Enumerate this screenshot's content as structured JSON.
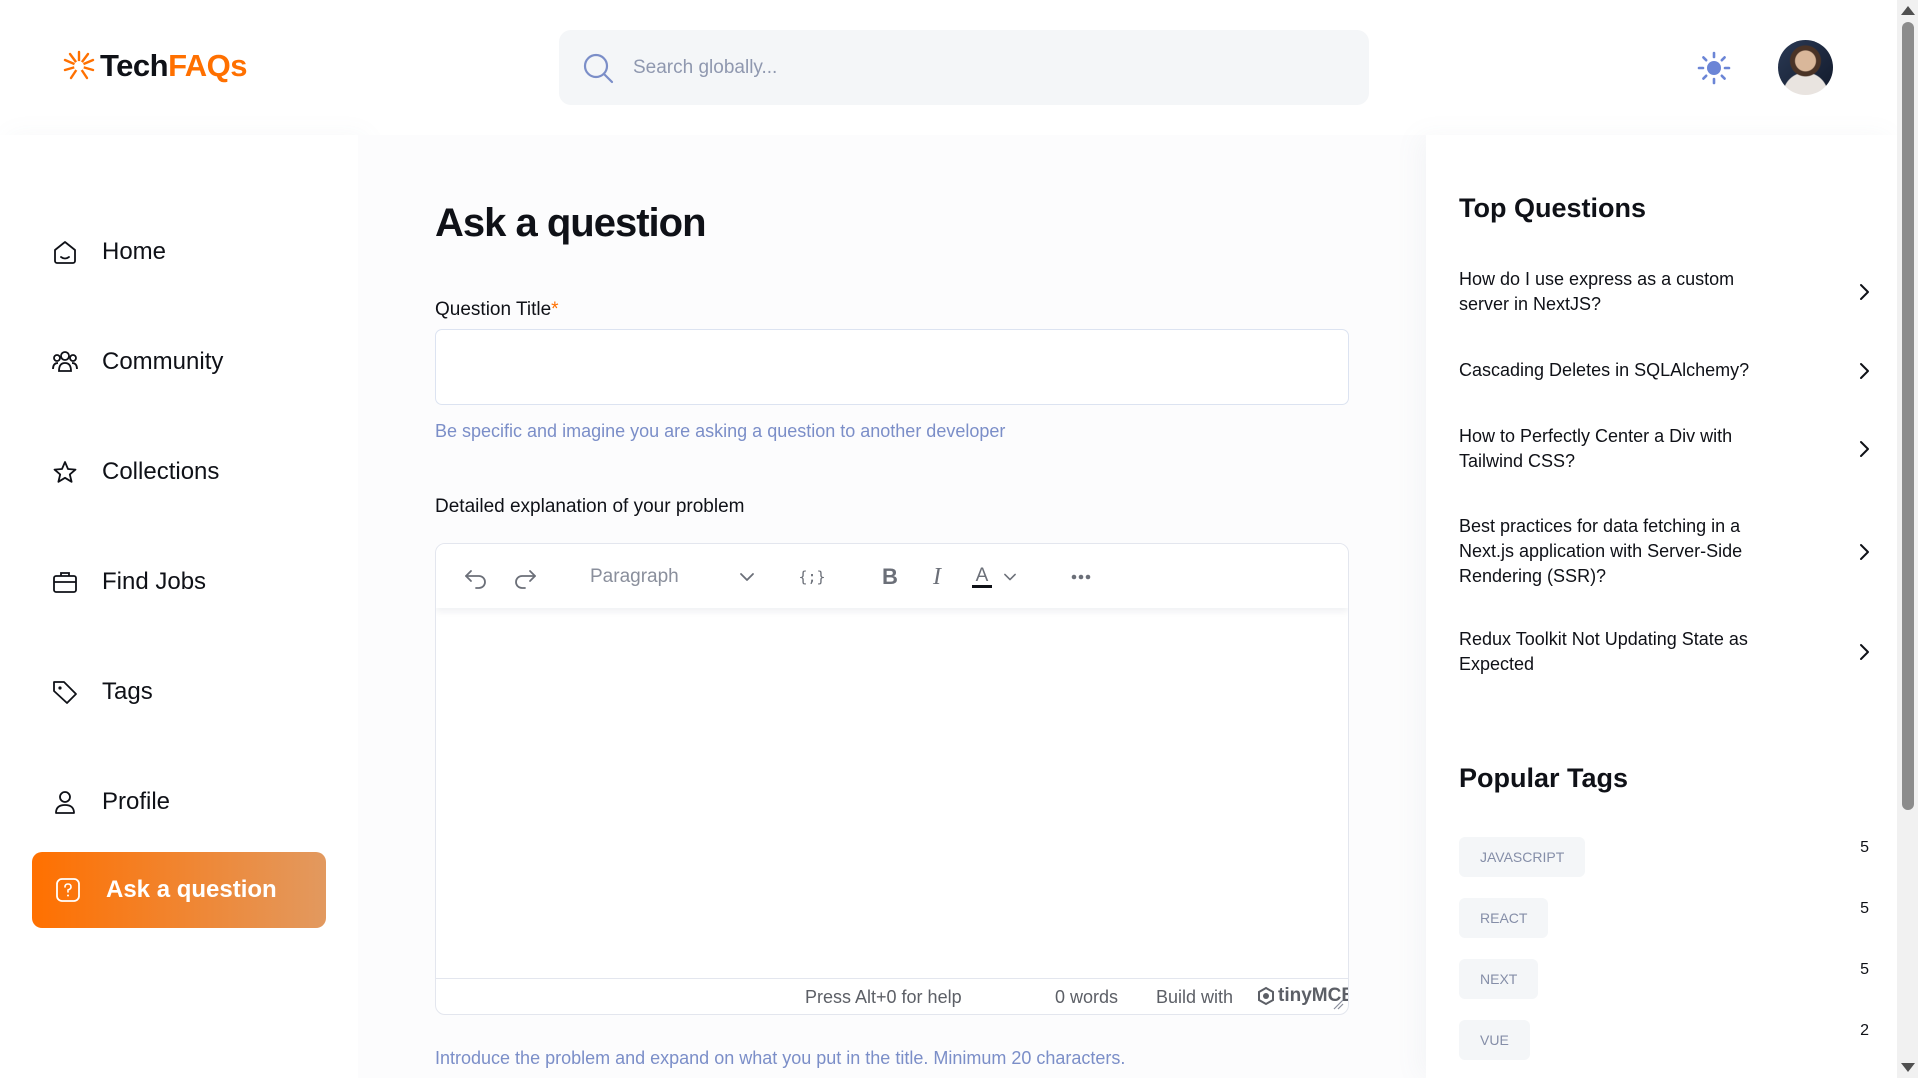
{
  "brand": {
    "name_part1": "Tech",
    "name_part2": "FAQs",
    "accent": "#ff7000"
  },
  "search": {
    "placeholder": "Search globally...",
    "icon": "search-icon"
  },
  "header": {
    "theme_icon": "sun-icon"
  },
  "sidebar": {
    "items": [
      {
        "label": "Home",
        "icon": "home-icon"
      },
      {
        "label": "Community",
        "icon": "users-icon"
      },
      {
        "label": "Collections",
        "icon": "star-icon"
      },
      {
        "label": "Find Jobs",
        "icon": "briefcase-icon"
      },
      {
        "label": "Tags",
        "icon": "tag-icon"
      },
      {
        "label": "Profile",
        "icon": "user-icon"
      }
    ],
    "ask_button": "Ask a question"
  },
  "main": {
    "title": "Ask a question",
    "question_title_label": "Question Title",
    "required_mark": "*",
    "question_title_value": "",
    "title_hint": "Be specific and imagine you are asking a question to another developer",
    "explanation_label": "Detailed explanation of your problem",
    "editor": {
      "block_format": "Paragraph",
      "help_text": "Press Alt+0 for help",
      "word_count": "0 words",
      "build_with": "Build with",
      "brand": "tinyMCE"
    },
    "explanation_hint": "Introduce the problem and expand on what you put in the title. Minimum 20 characters."
  },
  "rightbar": {
    "top_questions_title": "Top Questions",
    "questions": [
      "How do I use express as a custom server in NextJS?",
      "Cascading Deletes in SQLAlchemy?",
      "How to Perfectly Center a Div with Tailwind CSS?",
      "Best practices for data fetching in a Next.js application with Server-Side Rendering (SSR)?",
      "Redux Toolkit Not Updating State as Expected"
    ],
    "popular_tags_title": "Popular Tags",
    "tags": [
      {
        "name": "JAVASCRIPT",
        "count": "5"
      },
      {
        "name": "REACT",
        "count": "5"
      },
      {
        "name": "NEXT",
        "count": "5"
      },
      {
        "name": "VUE",
        "count": "2"
      }
    ]
  }
}
